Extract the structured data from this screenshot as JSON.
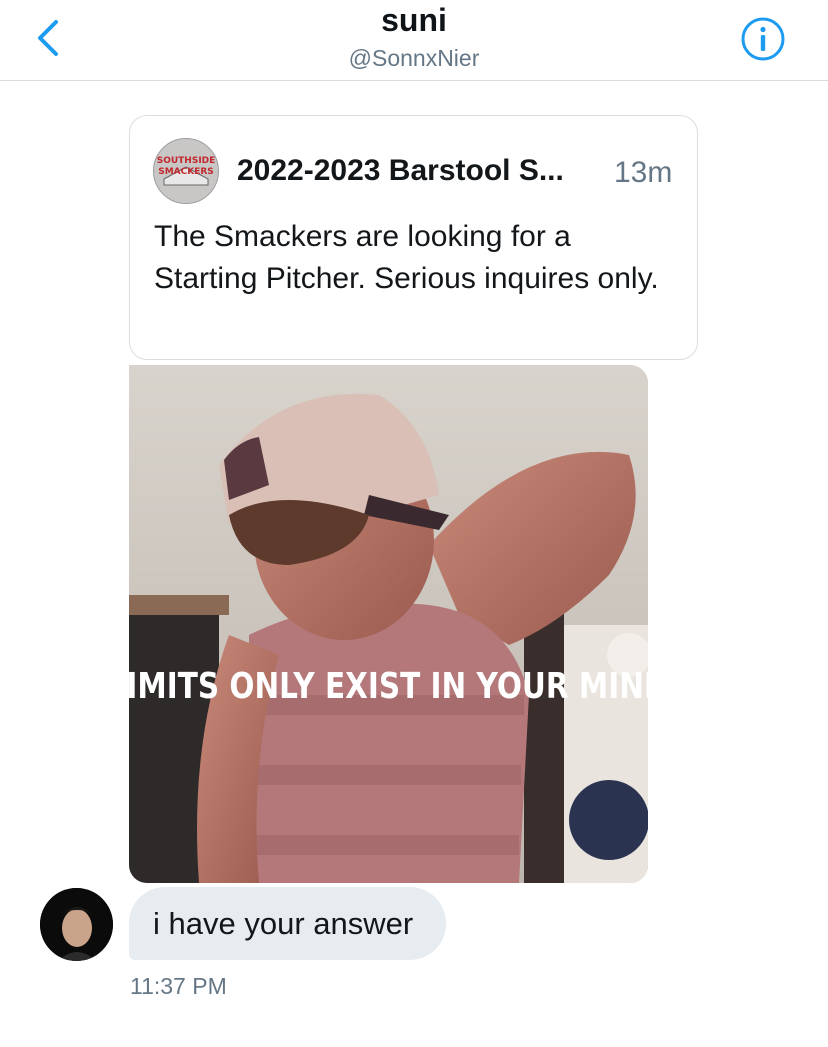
{
  "header": {
    "title": "suni",
    "handle": "@SonnxNier",
    "accent_color": "#1d9bf0",
    "back_icon": "chevron-left-icon",
    "info_icon": "info-circle-icon"
  },
  "shared_tweet": {
    "logo_text_line1": "SOUTHSIDE",
    "logo_text_line2": "SMACKERS",
    "account_name": "2022-2023 Barstool S...",
    "time": "13m",
    "text": "The Smackers are looking for a Starting Pitcher. Serious inquires only."
  },
  "media": {
    "caption": "LIMITS ONLY EXIST IN YOUR MIND"
  },
  "message": {
    "text": "i have your answer",
    "timestamp": "11:37 PM"
  }
}
